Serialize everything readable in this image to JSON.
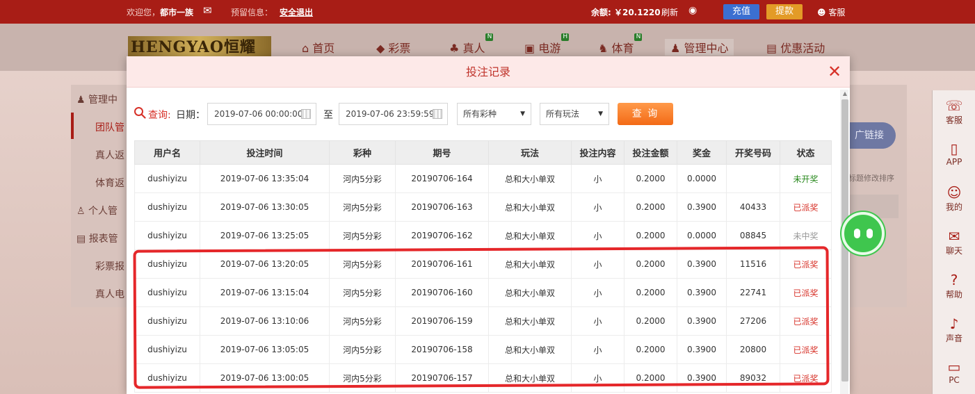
{
  "topbar": {
    "welcome": "欢迎您，",
    "username": "都市一族",
    "message_label": "预留信息：",
    "logout": "安全退出",
    "balance_label": "余额: ￥20.1220",
    "refresh": "刷新",
    "recharge": "充值",
    "withdraw": "提款",
    "service": "客服"
  },
  "logo": {
    "text": "HENGYAO恒耀"
  },
  "nav": [
    {
      "icon": "home-icon",
      "glyph": "⌂",
      "label": "首页"
    },
    {
      "icon": "lottery-icon",
      "glyph": "◆",
      "label": "彩票"
    },
    {
      "icon": "dealer-icon",
      "glyph": "♣",
      "label": "真人",
      "badge": "N"
    },
    {
      "icon": "game-icon",
      "glyph": "▣",
      "label": "电游",
      "badge": "H"
    },
    {
      "icon": "trophy-icon",
      "glyph": "♞",
      "label": "体育",
      "badge": "N"
    },
    {
      "icon": "team-icon",
      "glyph": "♟",
      "label": "管理中心"
    },
    {
      "icon": "gift-icon",
      "glyph": "▤",
      "label": "优惠活动"
    }
  ],
  "sidemenu": {
    "manage": "管理中",
    "team": "团队管",
    "live": "真人返",
    "sport": "体育返",
    "personal": "个人管",
    "report": "报表管",
    "lottery_report": "彩票报",
    "live_report": "真人电"
  },
  "promo": {
    "button": "广链接",
    "note": "标题修改排序"
  },
  "rail": [
    {
      "icon": "service-icon",
      "glyph": "☏",
      "label": "客服"
    },
    {
      "icon": "mobile-icon",
      "glyph": "▯",
      "label": "APP"
    },
    {
      "icon": "user-icon",
      "glyph": "☺",
      "label": "我的"
    },
    {
      "icon": "chat-icon",
      "glyph": "✉",
      "label": "聊天"
    },
    {
      "icon": "help-icon",
      "glyph": "?",
      "label": "帮助"
    },
    {
      "icon": "sound-icon",
      "glyph": "♪",
      "label": "声音"
    },
    {
      "icon": "pc-icon",
      "glyph": "▭",
      "label": "PC"
    }
  ],
  "modal": {
    "title": "投注记录",
    "close": "✕",
    "query_label": "查询:",
    "date_label": "日期：",
    "date_from": "2019-07-06 00:00:00",
    "to_label": "至",
    "date_to": "2019-07-06 23:59:59",
    "lottery_select": "所有彩种",
    "play_select": "所有玩法",
    "query_button": "查 询"
  },
  "table": {
    "headers": [
      "用户名",
      "投注时间",
      "彩种",
      "期号",
      "玩法",
      "投注内容",
      "投注金额",
      "奖金",
      "开奖号码",
      "状态"
    ],
    "rows": [
      [
        "dushiyizu",
        "2019-07-06 13:35:04",
        "河内5分彩",
        "20190706-164",
        "总和大小单双",
        "小",
        "0.2000",
        "0.0000",
        "",
        "未开奖"
      ],
      [
        "dushiyizu",
        "2019-07-06 13:30:05",
        "河内5分彩",
        "20190706-163",
        "总和大小单双",
        "小",
        "0.2000",
        "0.3900",
        "40433",
        "已派奖"
      ],
      [
        "dushiyizu",
        "2019-07-06 13:25:05",
        "河内5分彩",
        "20190706-162",
        "总和大小单双",
        "小",
        "0.2000",
        "0.0000",
        "08845",
        "未中奖"
      ],
      [
        "dushiyizu",
        "2019-07-06 13:20:05",
        "河内5分彩",
        "20190706-161",
        "总和大小单双",
        "小",
        "0.2000",
        "0.3900",
        "11516",
        "已派奖"
      ],
      [
        "dushiyizu",
        "2019-07-06 13:15:04",
        "河内5分彩",
        "20190706-160",
        "总和大小单双",
        "小",
        "0.2000",
        "0.3900",
        "22741",
        "已派奖"
      ],
      [
        "dushiyizu",
        "2019-07-06 13:10:06",
        "河内5分彩",
        "20190706-159",
        "总和大小单双",
        "小",
        "0.2000",
        "0.3900",
        "27206",
        "已派奖"
      ],
      [
        "dushiyizu",
        "2019-07-06 13:05:05",
        "河内5分彩",
        "20190706-158",
        "总和大小单双",
        "小",
        "0.2000",
        "0.3900",
        "20800",
        "已派奖"
      ],
      [
        "dushiyizu",
        "2019-07-06 13:00:05",
        "河内5分彩",
        "20190706-157",
        "总和大小单双",
        "小",
        "0.2000",
        "0.3900",
        "89032",
        "已派奖"
      ]
    ]
  },
  "colors": {
    "brand_red": "#a81d16",
    "accent_orange": "#f36a16",
    "status_paid": "#d73128",
    "status_pending": "#2a8a1f",
    "status_lost": "#999999",
    "annotation": "#e5272a"
  }
}
